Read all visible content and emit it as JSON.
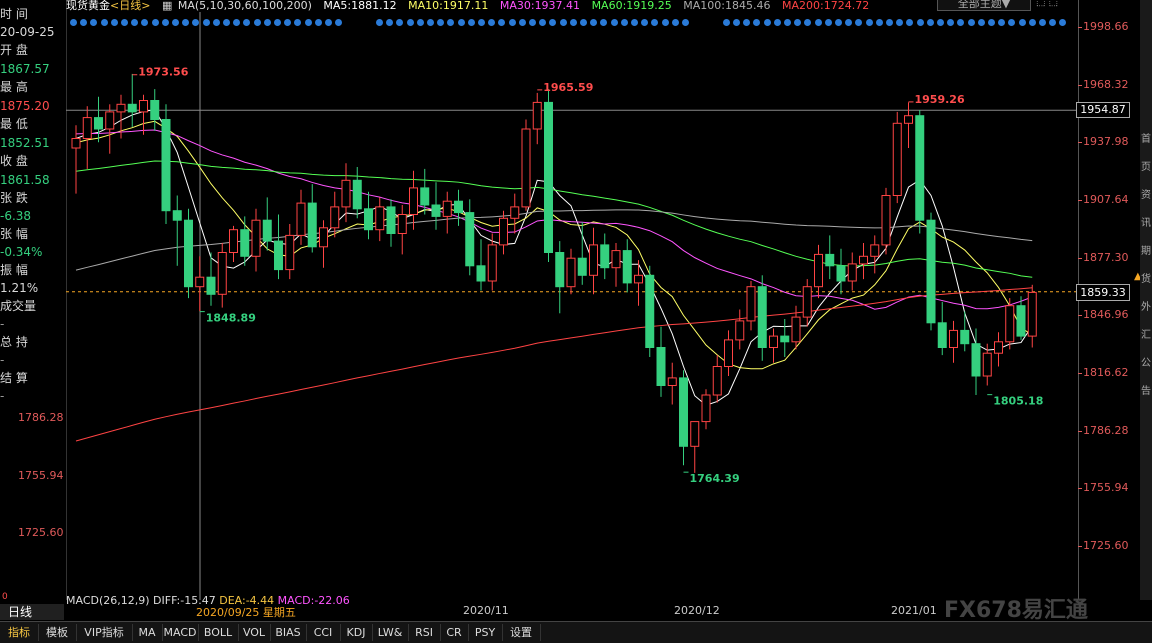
{
  "info_panel": {
    "time_label": "时 间",
    "date_value": "20-09-25",
    "open_label": "开 盘",
    "open_value": "1867.57",
    "high_label": "最 高",
    "high_value": "1875.20",
    "low_label": "最 低",
    "low_value": "1852.51",
    "close_label": "收 盘",
    "close_value": "1861.58",
    "change_label": "张 跌",
    "change_value": "-6.38",
    "pct_label": "张 幅",
    "pct_value": "-0.34%",
    "amp_label": "振 幅",
    "amp_value": "1.21%",
    "vol_label": "成交量",
    "vol_value": "-",
    "oi_label": "总 持",
    "oi_value": "-",
    "settle_label": "结 算",
    "settle_value": "-",
    "left_ticks": [
      "1786.28",
      "1755.94",
      "1725.60"
    ],
    "bottom_mark": "0"
  },
  "header": {
    "title": "现货黄金",
    "period": "<日线>",
    "ma_params": "MA(5,10,30,60,100,200)",
    "ma5": "MA5:1881.12",
    "ma10": "MA10:1917.11",
    "ma30": "MA30:1937.41",
    "ma60": "MA60:1919.25",
    "ma100": "MA100:1845.46",
    "ma200": "MA200:1724.72",
    "theme_button": "全部主题▼",
    "colors": {
      "ma5": "#ffffff",
      "ma10": "#ffff66",
      "ma30": "#ff55ff",
      "ma60": "#55ff55",
      "ma100": "#aaaaaa",
      "ma200": "#ff4444",
      "up": "#ff4444",
      "down": "#35d07f"
    }
  },
  "chart_data": {
    "type": "candlestick",
    "ylim": [
      1705,
      2005
    ],
    "y_ticks": [
      "1998.66",
      "1968.32",
      "1937.98",
      "1907.64",
      "1877.30",
      "1846.96",
      "1816.62",
      "1786.28",
      "1755.94",
      "1725.60"
    ],
    "x_labels": [
      "2020/11",
      "2020/12",
      "2021/01"
    ],
    "current_price": "1859.33",
    "crosshair_price": "1954.87",
    "annotations": [
      "1973.56",
      "1848.89",
      "1965.59",
      "1764.39",
      "1959.26",
      "1805.18"
    ],
    "candles": [
      [
        1935,
        1947,
        1911,
        1940
      ],
      [
        1940,
        1957,
        1924,
        1951
      ],
      [
        1951,
        1962,
        1938,
        1945
      ],
      [
        1945,
        1958,
        1932,
        1954
      ],
      [
        1954,
        1963,
        1940,
        1958
      ],
      [
        1958,
        1974,
        1946,
        1954
      ],
      [
        1954,
        1963,
        1942,
        1960
      ],
      [
        1960,
        1966,
        1944,
        1950
      ],
      [
        1950,
        1958,
        1895,
        1902
      ],
      [
        1902,
        1910,
        1873,
        1897
      ],
      [
        1897,
        1903,
        1856,
        1862
      ],
      [
        1862,
        1878,
        1849,
        1867
      ],
      [
        1867,
        1880,
        1852,
        1858
      ],
      [
        1858,
        1885,
        1851,
        1880
      ],
      [
        1880,
        1894,
        1875,
        1892
      ],
      [
        1892,
        1899,
        1873,
        1878
      ],
      [
        1878,
        1903,
        1870,
        1897
      ],
      [
        1897,
        1909,
        1881,
        1886
      ],
      [
        1886,
        1900,
        1866,
        1871
      ],
      [
        1871,
        1895,
        1866,
        1889
      ],
      [
        1889,
        1913,
        1884,
        1906
      ],
      [
        1906,
        1916,
        1880,
        1883
      ],
      [
        1883,
        1897,
        1872,
        1893
      ],
      [
        1893,
        1912,
        1888,
        1904
      ],
      [
        1904,
        1927,
        1896,
        1918
      ],
      [
        1918,
        1925,
        1898,
        1903
      ],
      [
        1903,
        1912,
        1887,
        1892
      ],
      [
        1892,
        1909,
        1886,
        1904
      ],
      [
        1904,
        1908,
        1883,
        1890
      ],
      [
        1890,
        1905,
        1879,
        1900
      ],
      [
        1900,
        1923,
        1892,
        1914
      ],
      [
        1914,
        1924,
        1900,
        1905
      ],
      [
        1905,
        1917,
        1892,
        1899
      ],
      [
        1899,
        1912,
        1890,
        1907
      ],
      [
        1907,
        1913,
        1894,
        1901
      ],
      [
        1901,
        1908,
        1868,
        1873
      ],
      [
        1873,
        1887,
        1860,
        1865
      ],
      [
        1865,
        1890,
        1860,
        1884
      ],
      [
        1884,
        1902,
        1879,
        1898
      ],
      [
        1898,
        1911,
        1890,
        1904
      ],
      [
        1904,
        1950,
        1902,
        1945
      ],
      [
        1945,
        1964,
        1937,
        1959
      ],
      [
        1959,
        1966,
        1875,
        1880
      ],
      [
        1880,
        1886,
        1848,
        1862
      ],
      [
        1862,
        1882,
        1858,
        1877
      ],
      [
        1877,
        1896,
        1863,
        1868
      ],
      [
        1868,
        1893,
        1858,
        1884
      ],
      [
        1884,
        1890,
        1866,
        1872
      ],
      [
        1872,
        1885,
        1862,
        1881
      ],
      [
        1881,
        1887,
        1859,
        1864
      ],
      [
        1864,
        1876,
        1852,
        1868
      ],
      [
        1868,
        1873,
        1825,
        1830
      ],
      [
        1830,
        1841,
        1804,
        1810
      ],
      [
        1810,
        1822,
        1800,
        1814
      ],
      [
        1814,
        1818,
        1768,
        1778
      ],
      [
        1778,
        1788,
        1764,
        1791
      ],
      [
        1791,
        1808,
        1787,
        1805
      ],
      [
        1805,
        1826,
        1801,
        1820
      ],
      [
        1820,
        1839,
        1815,
        1834
      ],
      [
        1834,
        1850,
        1829,
        1844
      ],
      [
        1844,
        1865,
        1839,
        1862
      ],
      [
        1862,
        1868,
        1823,
        1830
      ],
      [
        1830,
        1840,
        1822,
        1836
      ],
      [
        1836,
        1845,
        1825,
        1833
      ],
      [
        1833,
        1852,
        1829,
        1846
      ],
      [
        1846,
        1866,
        1841,
        1862
      ],
      [
        1862,
        1884,
        1856,
        1879
      ],
      [
        1879,
        1889,
        1866,
        1873
      ],
      [
        1873,
        1882,
        1858,
        1865
      ],
      [
        1865,
        1880,
        1860,
        1874
      ],
      [
        1874,
        1885,
        1866,
        1878
      ],
      [
        1878,
        1889,
        1869,
        1884
      ],
      [
        1884,
        1914,
        1879,
        1910
      ],
      [
        1910,
        1954,
        1906,
        1948
      ],
      [
        1948,
        1959,
        1935,
        1952
      ],
      [
        1952,
        1955,
        1890,
        1897
      ],
      [
        1897,
        1901,
        1839,
        1843
      ],
      [
        1843,
        1854,
        1826,
        1830
      ],
      [
        1830,
        1844,
        1822,
        1839
      ],
      [
        1839,
        1849,
        1828,
        1832
      ],
      [
        1832,
        1840,
        1805,
        1815
      ],
      [
        1815,
        1832,
        1810,
        1827
      ],
      [
        1827,
        1838,
        1820,
        1833
      ],
      [
        1833,
        1856,
        1829,
        1852
      ],
      [
        1852,
        1857,
        1834,
        1836
      ],
      [
        1836,
        1863,
        1830,
        1859
      ]
    ]
  },
  "macd": {
    "label": "MACD(26,12,9)",
    "diff": "DIFF:-15.47",
    "dea": "DEA:-4.44",
    "macd": "MACD:-22.06"
  },
  "cursor_date": "2020/09/25 星期五",
  "tabs": [
    "指标",
    "模板",
    "VIP指标",
    "MA",
    "MACD",
    "BOLL",
    "VOL",
    "BIAS",
    "CCI",
    "KDJ",
    "LW&",
    "RSI",
    "CR",
    "PSY",
    "设置"
  ],
  "period_button": "日线",
  "watermark": "FX678易汇通",
  "right_strip": [
    "首",
    "页",
    "资",
    "讯",
    "期",
    "货",
    "外",
    "汇",
    "公",
    "告"
  ]
}
